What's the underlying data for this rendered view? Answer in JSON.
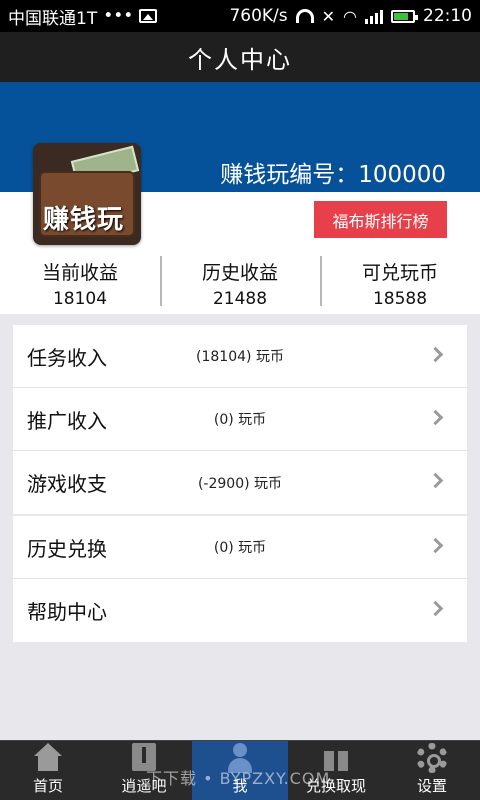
{
  "status_bar": {
    "carrier": "中国联通1T",
    "dots": "•••",
    "speed": "760K/s",
    "time": "22:10"
  },
  "header": {
    "title": "个人中心"
  },
  "profile": {
    "avatar_text": "赚钱玩",
    "user_id_text": "赚钱玩编号：100000",
    "rank_button": "福布斯排行榜"
  },
  "stats": [
    {
      "label": "当前收益",
      "value": "18104"
    },
    {
      "label": "历史收益",
      "value": "21488"
    },
    {
      "label": "可兑玩币",
      "value": "18588"
    }
  ],
  "menu": [
    {
      "title": "任务收入",
      "amount": "(18104) 玩币"
    },
    {
      "title": "推广收入",
      "amount": "(0) 玩币"
    },
    {
      "title": "游戏收支",
      "amount": "(-2900) 玩币"
    },
    {
      "title": "历史兑换",
      "amount": "(0) 玩币"
    },
    {
      "title": "帮助中心",
      "amount": ""
    }
  ],
  "tabs": [
    {
      "label": "首页",
      "icon": "home-icon"
    },
    {
      "label": "逍遥吧",
      "icon": "book-icon"
    },
    {
      "label": "我",
      "icon": "user-icon",
      "active": true
    },
    {
      "label": "兑换取现",
      "icon": "gift-icon"
    },
    {
      "label": "设置",
      "icon": "gear-icon"
    }
  ],
  "watermark": "下下载 • BYPZXY.COM",
  "colors": {
    "header_blue": "#06529a",
    "accent_red": "#e8404a",
    "active_tab": "#1e4f8f"
  }
}
